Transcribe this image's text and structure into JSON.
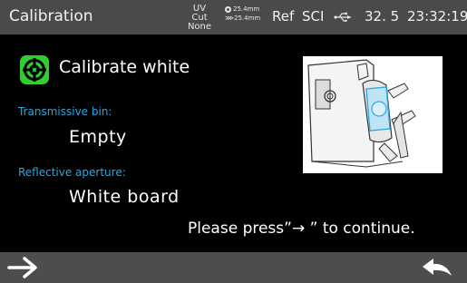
{
  "status_bar": {
    "title": "Calibration",
    "uv_top": "UV",
    "uv_bottom": "Cut None",
    "aperture_measure": "25.4mm",
    "aperture_illum": "25.4mm",
    "ref": "Ref",
    "sci": "SCI",
    "usb_icon": "usb-icon",
    "temperature": "32. 5",
    "time": "23:32:19"
  },
  "main": {
    "title": "Calibrate white",
    "title_icon": "gear-icon",
    "fields": [
      {
        "label": "Transmissive bin:",
        "value": "Empty"
      },
      {
        "label": "Reflective aperture:",
        "value": "White board"
      }
    ],
    "prompt": "Please press”→ ”  to continue."
  },
  "bottom_bar": {
    "next_icon": "arrow-right-icon",
    "back_icon": "return-icon"
  },
  "colors": {
    "accent_blue": "#2aa7e0",
    "accent_green": "#33cc33",
    "bar_gray": "#4a4a4a"
  }
}
